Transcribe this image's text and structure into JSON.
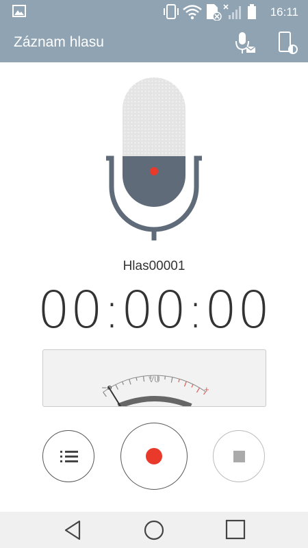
{
  "status_bar": {
    "time": "16:11",
    "icons": [
      "gallery-icon",
      "vibrate-icon",
      "wifi-icon",
      "sim-off-icon",
      "signal-icon",
      "battery-icon"
    ]
  },
  "app_bar": {
    "title": "Záznam hlasu",
    "actions": [
      "mic-settings-icon",
      "screen-recorder-icon"
    ]
  },
  "recording": {
    "name": "Hlas00001",
    "elapsed": "00:00:00",
    "indicator_color": "#e8392b"
  },
  "vu_meter": {
    "label": "VU",
    "minus": "–",
    "plus": "+",
    "level": 0
  },
  "controls": {
    "list": "list-icon",
    "record": "record-icon",
    "stop": "stop-icon"
  },
  "nav": [
    "back-icon",
    "home-icon",
    "recents-icon"
  ],
  "colors": {
    "bar": "#8fa3b3",
    "mic_body": "#5f6b78",
    "record": "#e8392b",
    "accent_red": "#e05a5a"
  }
}
